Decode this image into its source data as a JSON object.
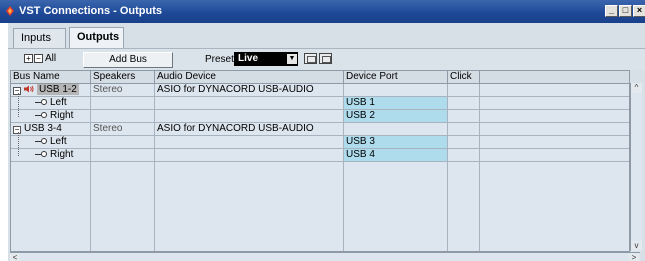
{
  "window": {
    "title": "VST Connections - Outputs"
  },
  "tabs": [
    {
      "label": "Inputs",
      "active": false
    },
    {
      "label": "Outputs",
      "active": true
    }
  ],
  "toolbar": {
    "expand_all_label": "All",
    "add_bus_label": "Add Bus",
    "presets_label": "Presets",
    "presets_value": "Live"
  },
  "table": {
    "columns": [
      "Bus Name",
      "Speakers",
      "Audio Device",
      "Device Port",
      "Click"
    ],
    "rows": [
      {
        "type": "bus",
        "name": "USB 1-2",
        "speakers": "Stereo",
        "device": "ASIO for DYNACORD USB-AUDIO",
        "port": "",
        "click": ""
      },
      {
        "type": "channel",
        "name": "Left",
        "speakers": "",
        "device": "",
        "port": "USB 1",
        "click": ""
      },
      {
        "type": "channel",
        "name": "Right",
        "speakers": "",
        "device": "",
        "port": "USB 2",
        "click": ""
      },
      {
        "type": "bus",
        "name": "USB 3-4",
        "speakers": "Stereo",
        "device": "ASIO for DYNACORD USB-AUDIO",
        "port": "",
        "click": ""
      },
      {
        "type": "channel",
        "name": "Left",
        "speakers": "",
        "device": "",
        "port": "USB 3",
        "click": ""
      },
      {
        "type": "channel",
        "name": "Right",
        "speakers": "",
        "device": "",
        "port": "USB 4",
        "click": ""
      }
    ]
  },
  "colors": {
    "titlebar": "#1f4a98",
    "port_highlight": "#aedcec",
    "panel": "#d7dfe7"
  }
}
